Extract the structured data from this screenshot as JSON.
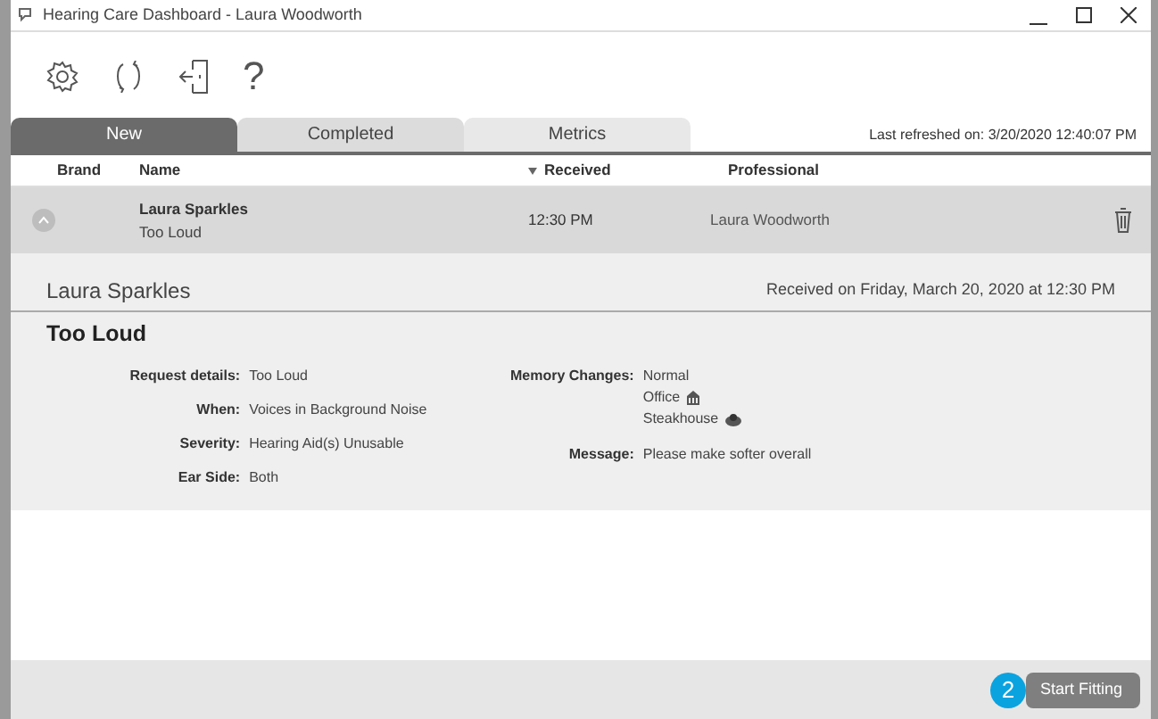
{
  "window": {
    "title": "Hearing Care Dashboard - Laura Woodworth"
  },
  "toolbar": {
    "help": "?"
  },
  "tabs": [
    {
      "label": "New",
      "selected": true
    },
    {
      "label": "Completed",
      "selected": false
    },
    {
      "label": "Metrics",
      "selected": false
    }
  ],
  "last_refreshed": "Last refreshed on: 3/20/2020 12:40:07 PM",
  "table": {
    "columns": [
      "Brand",
      "Name",
      "Received",
      "Professional"
    ],
    "rows": [
      {
        "name": "Laura Sparkles",
        "issue": "Too Loud",
        "received": "12:30 PM",
        "professional": "Laura Woodworth",
        "expanded": true
      }
    ]
  },
  "detail": {
    "name": "Laura Sparkles",
    "received": "Received on Friday, March 20, 2020 at 12:30 PM",
    "title": "Too Loud",
    "left_fields": [
      {
        "label": "Request details:",
        "value": "Too Loud"
      },
      {
        "label": "When:",
        "value": "Voices in Background Noise"
      },
      {
        "label": "Severity:",
        "value": "Hearing Aid(s) Unusable"
      },
      {
        "label": "Ear Side:",
        "value": "Both"
      }
    ],
    "memory_changes": {
      "label": "Memory Changes:",
      "items": [
        {
          "label": "Normal",
          "kind": "plain"
        },
        {
          "label": "Office",
          "kind": "building"
        },
        {
          "label": "Steakhouse",
          "kind": "food"
        }
      ]
    },
    "message": {
      "label": "Message:",
      "value": "Please make softer overall"
    }
  },
  "footer": {
    "badge": "2",
    "button": "Start Fitting"
  }
}
